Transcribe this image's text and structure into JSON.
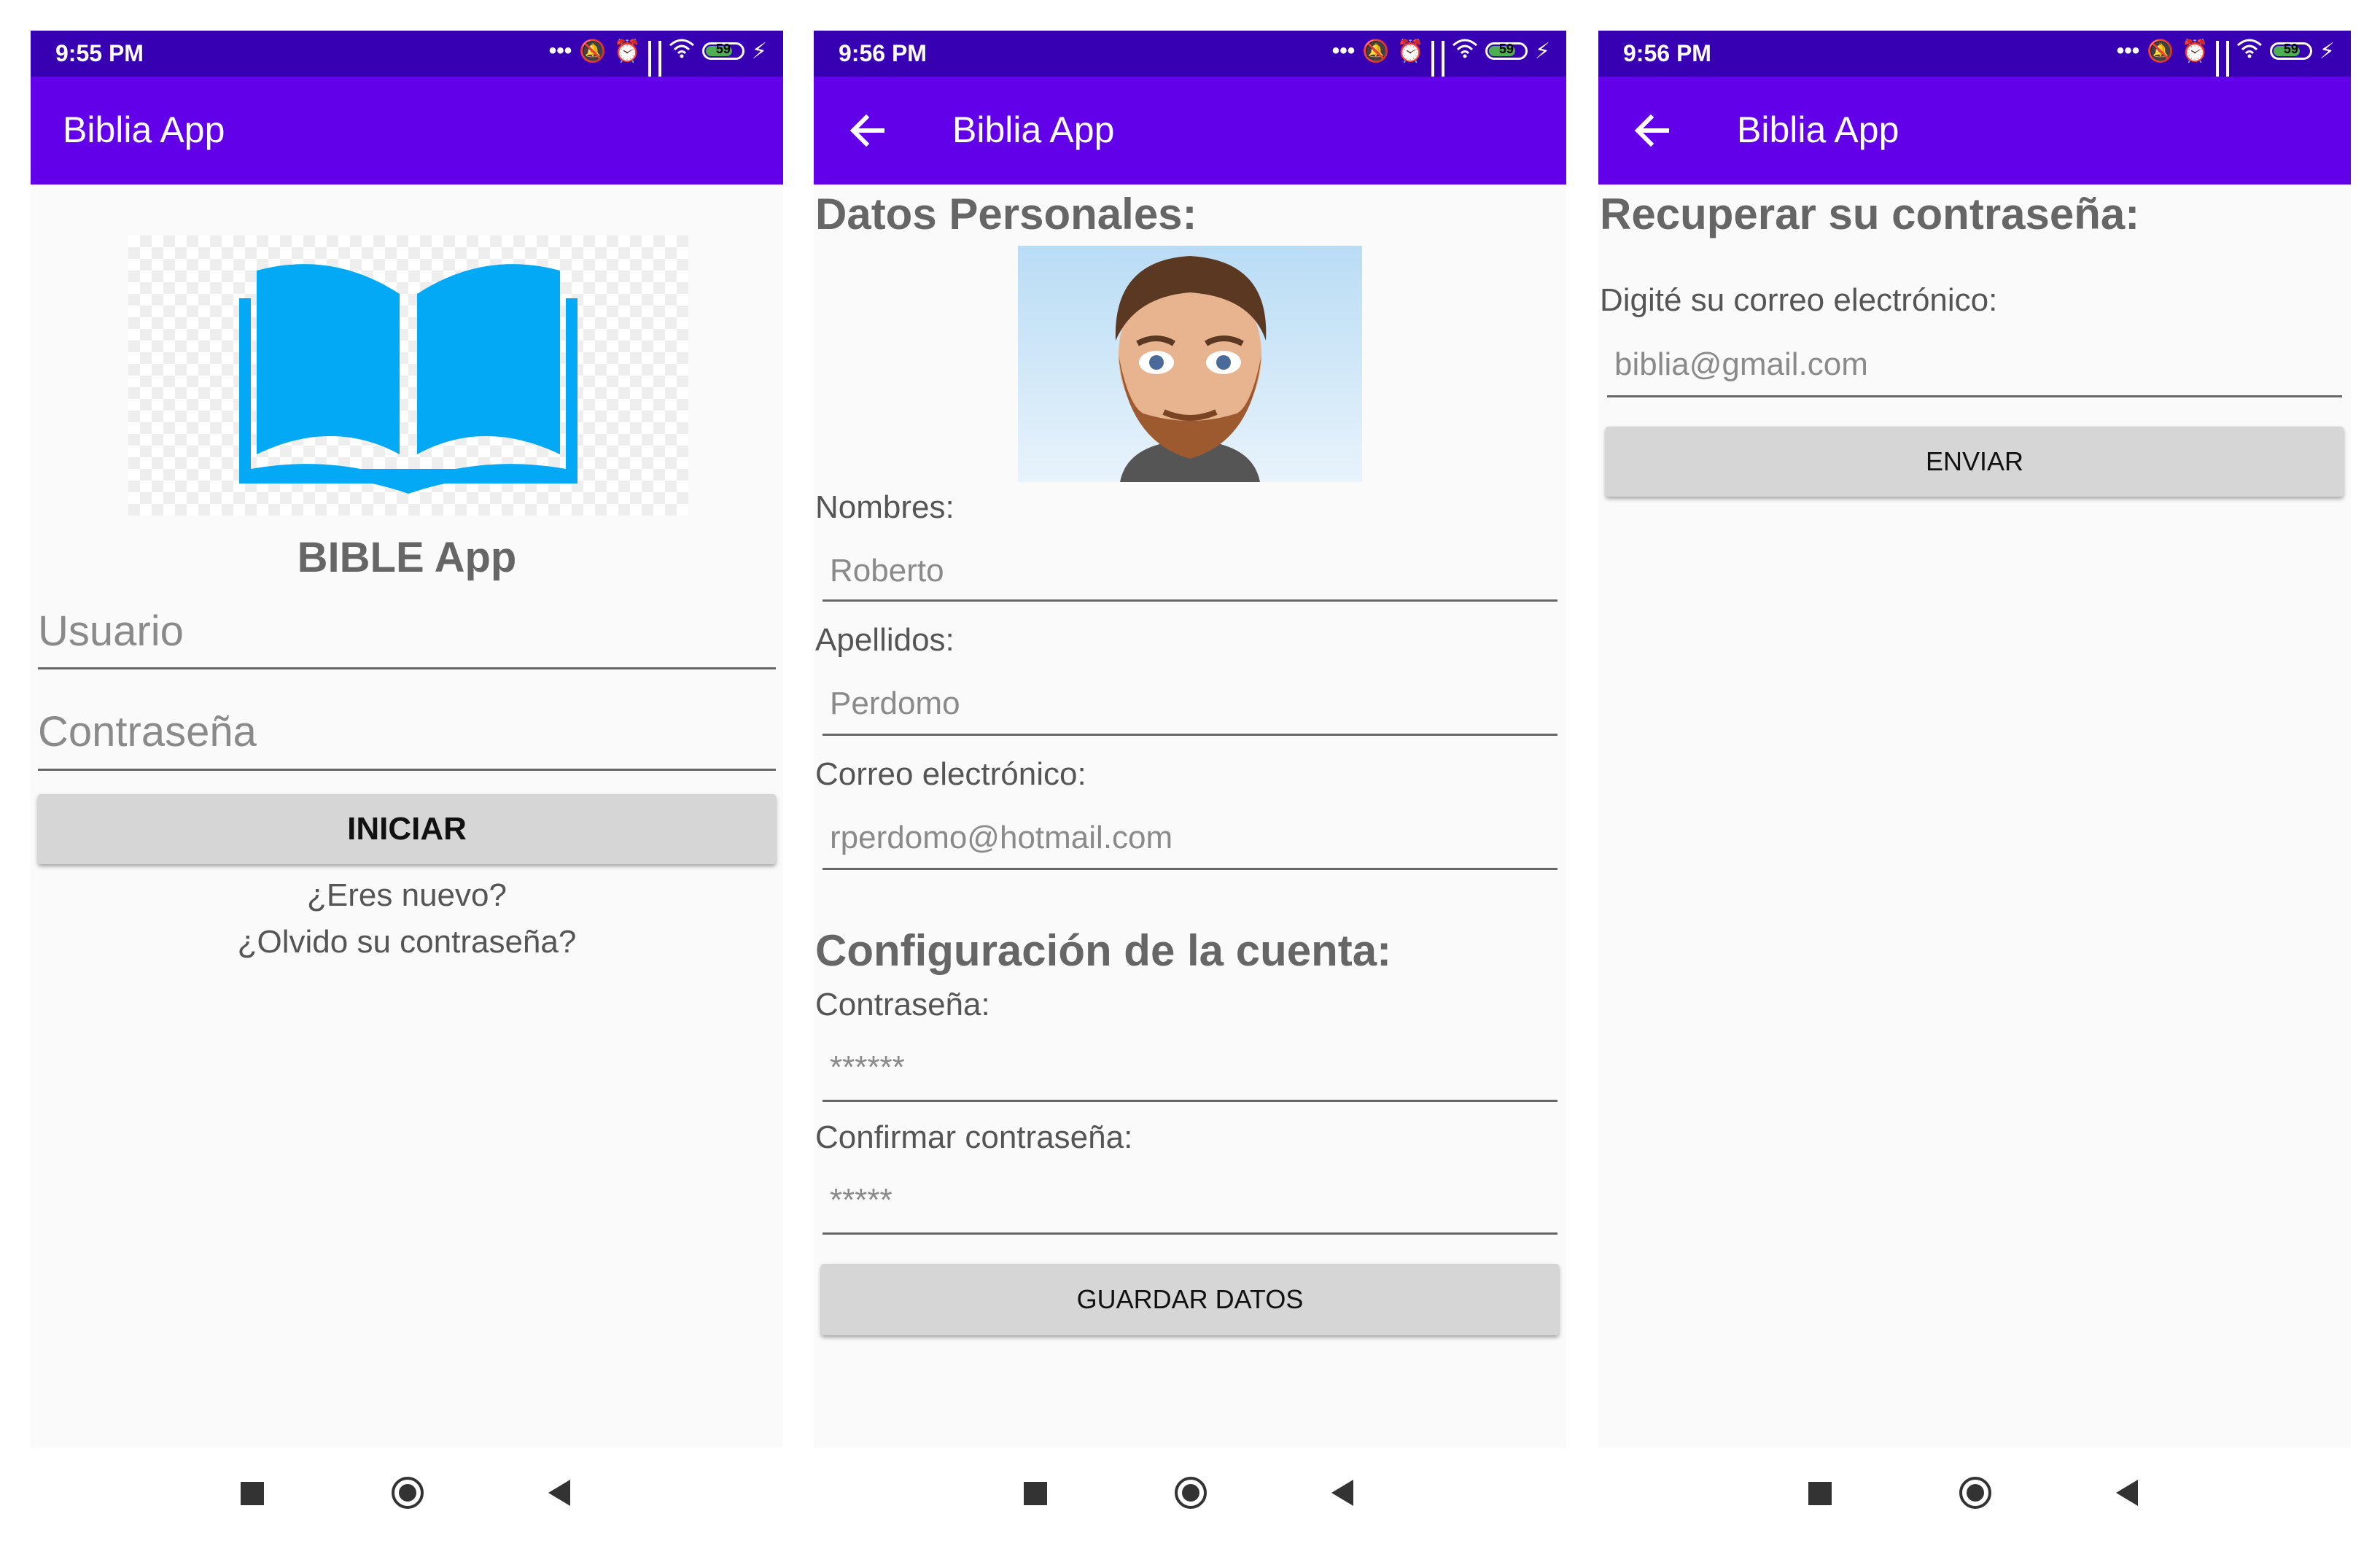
{
  "colors": {
    "status_bar": "#3700b3",
    "app_bar": "#6200ea",
    "button": "#d6d6d6",
    "book_blue": "#03a9f4"
  },
  "screens": {
    "login": {
      "status": {
        "time": "9:55 PM",
        "battery": "59"
      },
      "app_bar": {
        "title": "Biblia App"
      },
      "logo_icon": "book-icon",
      "app_name": "BIBLE App",
      "username_placeholder": "Usuario",
      "password_placeholder": "Contraseña",
      "login_button": "INICIAR",
      "new_user_link": "¿Eres nuevo?",
      "forgot_password_link": "¿Olvido su contraseña?"
    },
    "profile": {
      "status": {
        "time": "9:56 PM",
        "battery": "59"
      },
      "app_bar": {
        "title": "Biblia App"
      },
      "personal_title": "Datos Personales:",
      "first_name_label": "Nombres:",
      "first_name_value": "Roberto",
      "last_name_label": "Apellidos:",
      "last_name_value": "Perdomo",
      "email_label": "Correo electrónico:",
      "email_value": "rperdomo@hotmail.com",
      "account_title": "Configuración de la cuenta:",
      "password_label": "Contraseña:",
      "password_value": "******",
      "confirm_label": "Confirmar contraseña:",
      "confirm_value": "*****",
      "save_button": "GUARDAR DATOS"
    },
    "recover": {
      "status": {
        "time": "9:56 PM",
        "battery": "59"
      },
      "app_bar": {
        "title": "Biblia App"
      },
      "title": "Recuperar su contraseña:",
      "instruction": "Digité su correo electrónico:",
      "email_value": "biblia@gmail.com",
      "send_button": "ENVIAR"
    }
  }
}
